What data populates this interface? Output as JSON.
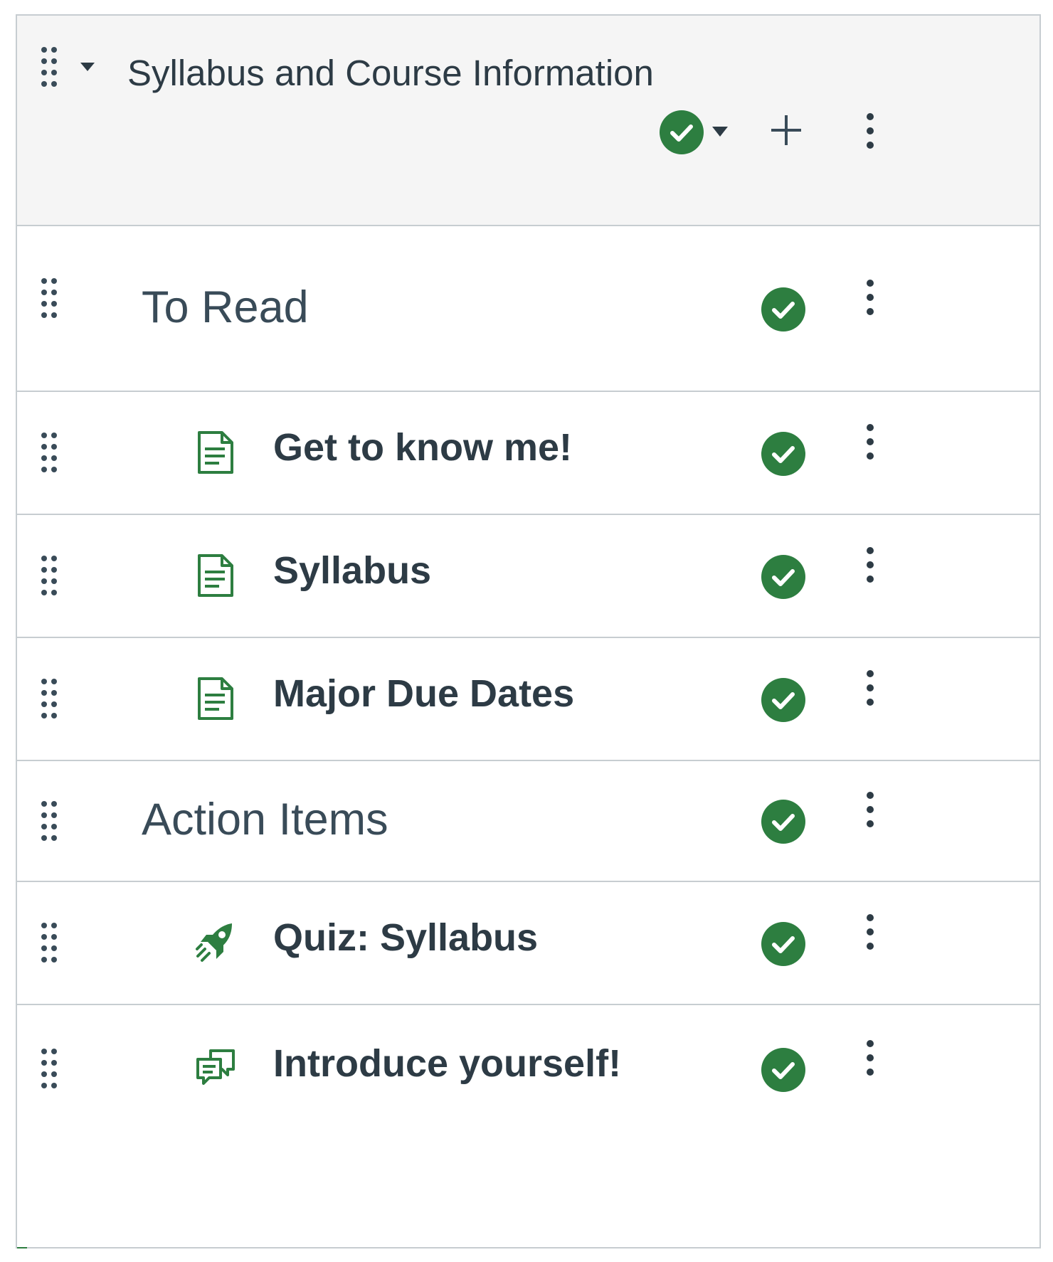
{
  "module": {
    "title": "Syllabus and Course Information",
    "accent_color": "#2d7e40",
    "header_bg": "#f5f5f5",
    "header_icons": [
      "drag-handle-icon",
      "collapse-caret-icon",
      "published-check-icon",
      "status-caret-icon",
      "add-plus-icon",
      "kebab-menu-icon"
    ]
  },
  "items": [
    {
      "label": "To Read",
      "kind": "subheader",
      "icon": "",
      "status": "published"
    },
    {
      "label": "Get to know me!",
      "kind": "item",
      "icon": "page-icon",
      "status": "published"
    },
    {
      "label": "Syllabus",
      "kind": "item",
      "icon": "page-icon",
      "status": "published"
    },
    {
      "label": "Major Due Dates",
      "kind": "item",
      "icon": "page-icon",
      "status": "published"
    },
    {
      "label": "Action Items",
      "kind": "subheader",
      "icon": "",
      "status": "published"
    },
    {
      "label": "Quiz: Syllabus",
      "kind": "item",
      "icon": "quiz-rocket-icon",
      "status": "published"
    },
    {
      "label": "Introduce yourself!",
      "kind": "item",
      "icon": "discussion-icon",
      "status": "published"
    }
  ]
}
